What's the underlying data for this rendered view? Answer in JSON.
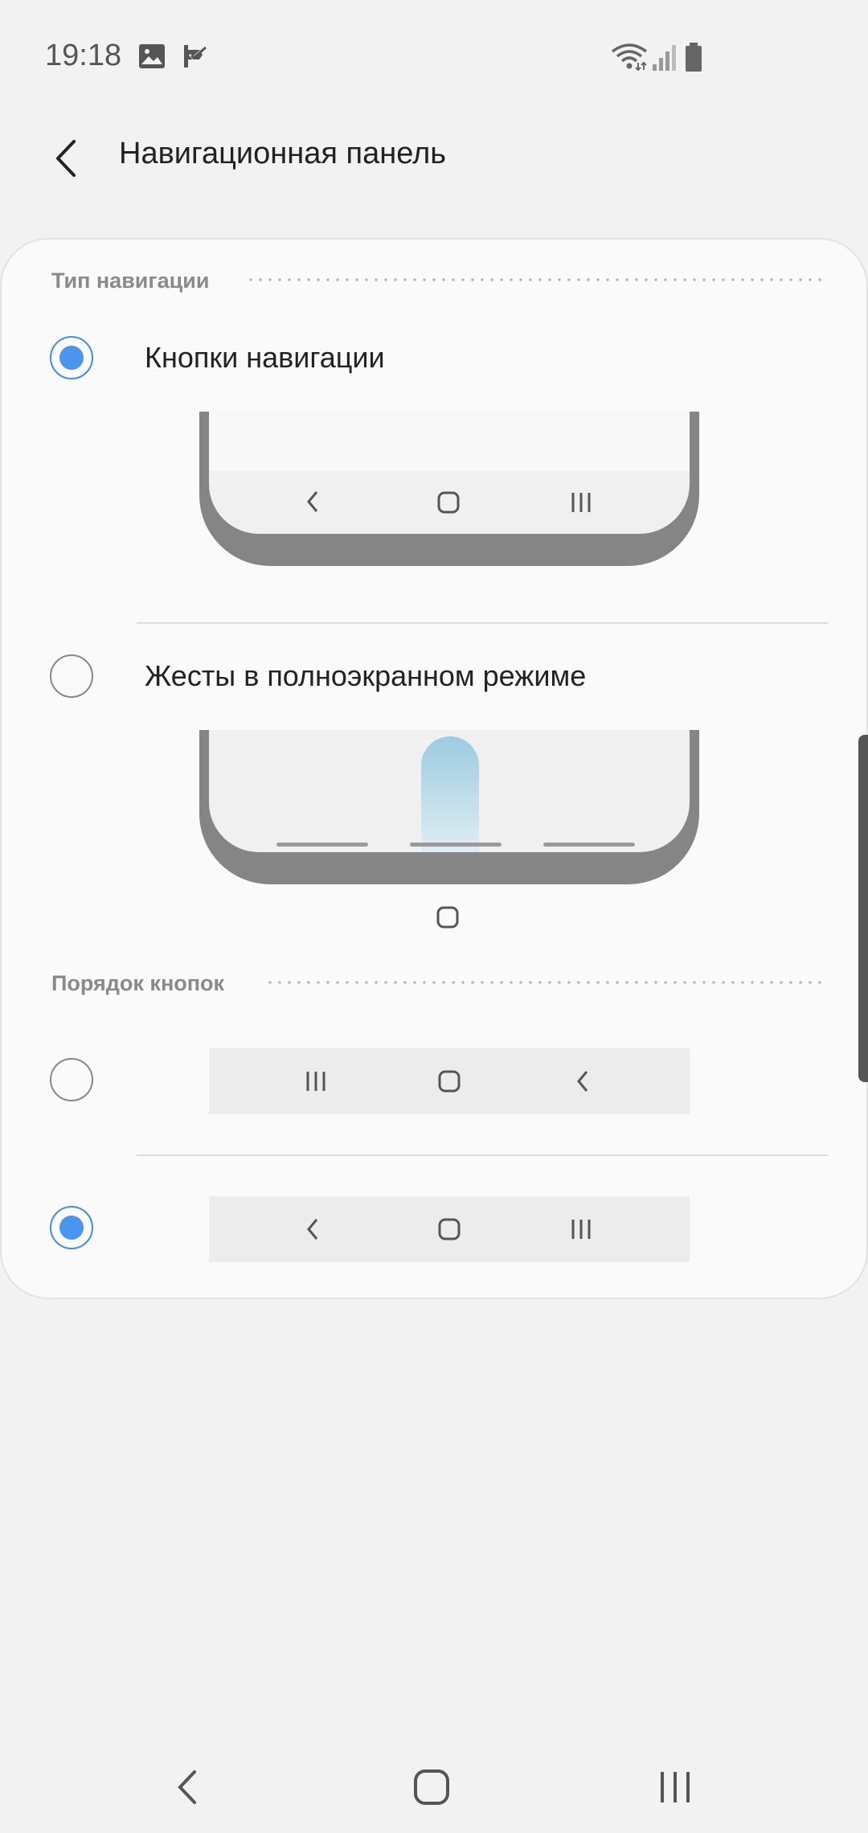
{
  "status_bar": {
    "time": "19:18",
    "icons": [
      "image-icon",
      "check-flag-icon",
      "wifi-icon",
      "signal-icon",
      "battery-icon"
    ]
  },
  "header": {
    "title": "Навигационная панель",
    "back_icon": "back-arrow-icon"
  },
  "navigation_type": {
    "section_title": "Тип навигации",
    "options": [
      {
        "label": "Кнопки навигации",
        "selected": true
      },
      {
        "label": "Жесты в полноэкранном режиме",
        "selected": false
      }
    ]
  },
  "button_order": {
    "section_title": "Порядок кнопок",
    "options": [
      {
        "order": [
          "recents",
          "home",
          "back"
        ],
        "selected": false
      },
      {
        "order": [
          "back",
          "home",
          "recents"
        ],
        "selected": true
      }
    ]
  },
  "system_nav": {
    "buttons": [
      "back-icon",
      "home-icon",
      "recents-icon"
    ]
  },
  "colors": {
    "accent": "#4a96ee",
    "background": "#f2f2f2",
    "card": "#fafafa",
    "section_header": "#8a8a8a"
  }
}
